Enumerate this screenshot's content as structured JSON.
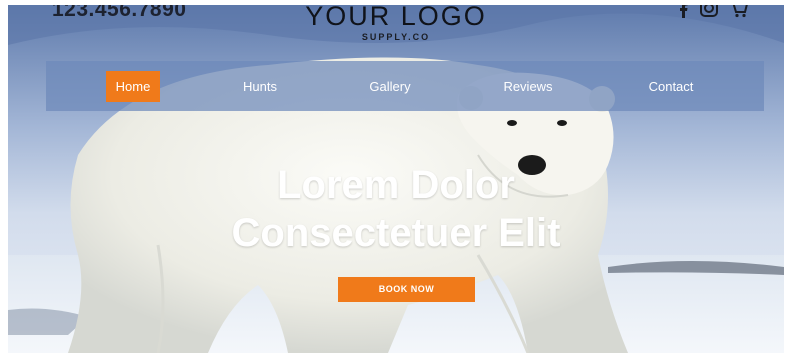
{
  "header": {
    "phone": "123.456.7890",
    "logo_title": "YOUR LOGO",
    "logo_subtitle": "SUPPLY.CO",
    "social_icons": [
      "facebook-icon",
      "instagram-icon",
      "cart-icon"
    ]
  },
  "nav": {
    "items": [
      {
        "label": "Home",
        "active": true
      },
      {
        "label": "Hunts",
        "active": false
      },
      {
        "label": "Gallery",
        "active": false
      },
      {
        "label": "Reviews",
        "active": false
      },
      {
        "label": "Contact",
        "active": false
      }
    ]
  },
  "hero": {
    "headline_line1": "Lorem Dolor",
    "headline_line2": "Consectetuer Elit",
    "cta_label": "BOOK NOW"
  },
  "colors": {
    "accent": "#f07a1a",
    "nav_background": "#6e89ba",
    "text_light": "#ffffff",
    "text_dark": "#1d2230"
  }
}
